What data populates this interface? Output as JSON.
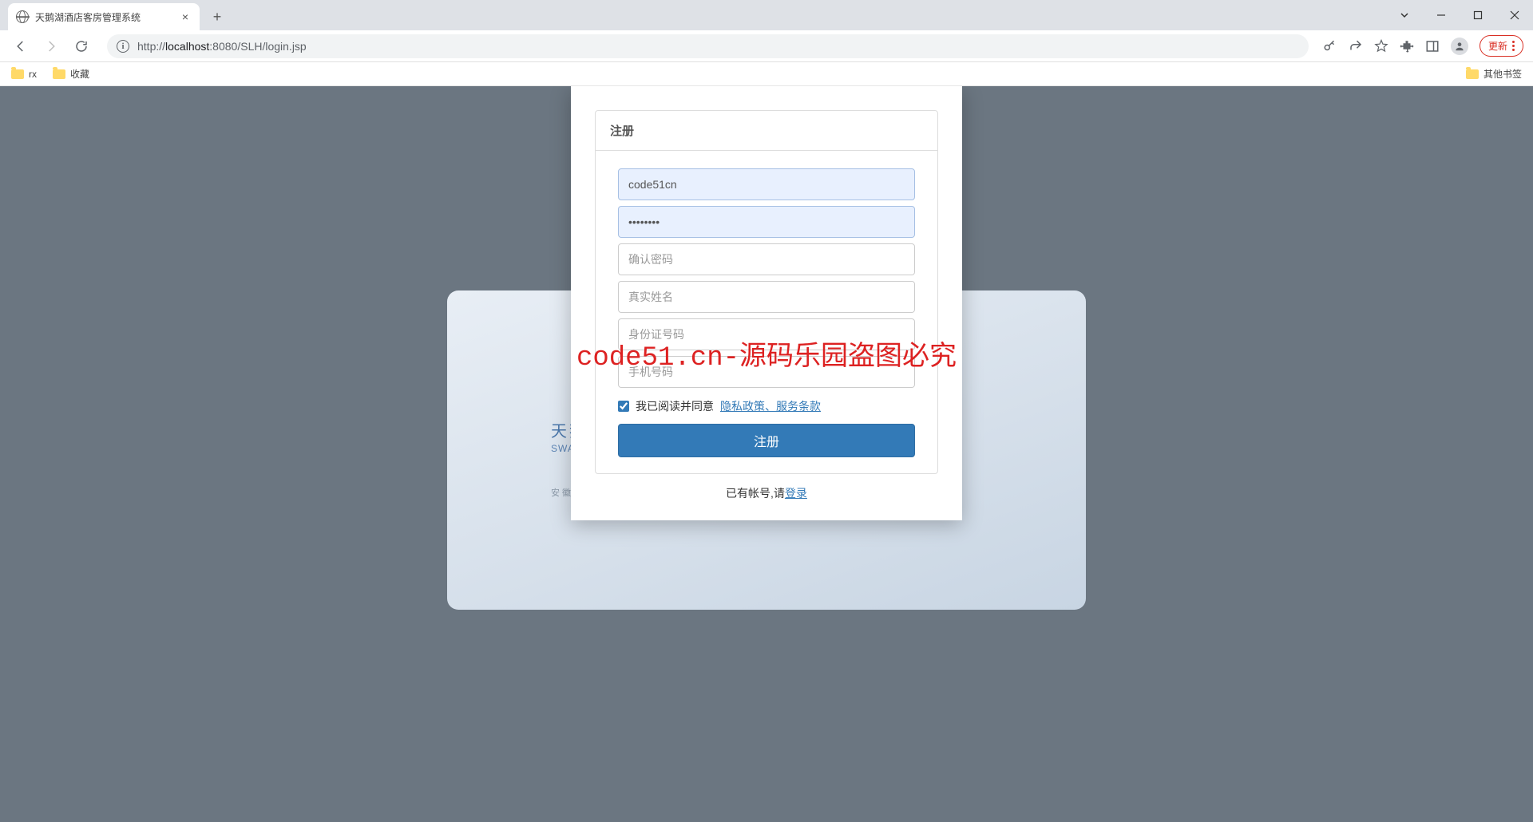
{
  "browser": {
    "tab": {
      "title": "天鹅湖酒店客房管理系统"
    },
    "url": {
      "protocol": "http://",
      "host": "localhost",
      "port": ":8080",
      "path": "/SLH/login.jsp"
    },
    "update_label": "更新",
    "bookmarks": [
      {
        "label": "rx"
      },
      {
        "label": "收藏"
      }
    ],
    "other_bookmarks": "其他书签"
  },
  "background": {
    "title_cn": "天鹅",
    "title_en": "SWAN",
    "subtitle": "安  徽"
  },
  "form": {
    "header": "注册",
    "fields": {
      "username": {
        "value": "code51cn"
      },
      "password": {
        "value": "••••••••"
      },
      "confirm_password": {
        "placeholder": "确认密码"
      },
      "realname": {
        "placeholder": "真实姓名"
      },
      "idcard": {
        "placeholder": "身份证号码"
      },
      "phone": {
        "placeholder": "手机号码"
      }
    },
    "agree": {
      "checked": true,
      "prefix": "我已阅读并同意",
      "link": "隐私政策、服务条款"
    },
    "submit_label": "注册",
    "footer": {
      "prefix": "已有帐号,请",
      "link": "登录"
    }
  },
  "watermark": "code51.cn-源码乐园盗图必究"
}
